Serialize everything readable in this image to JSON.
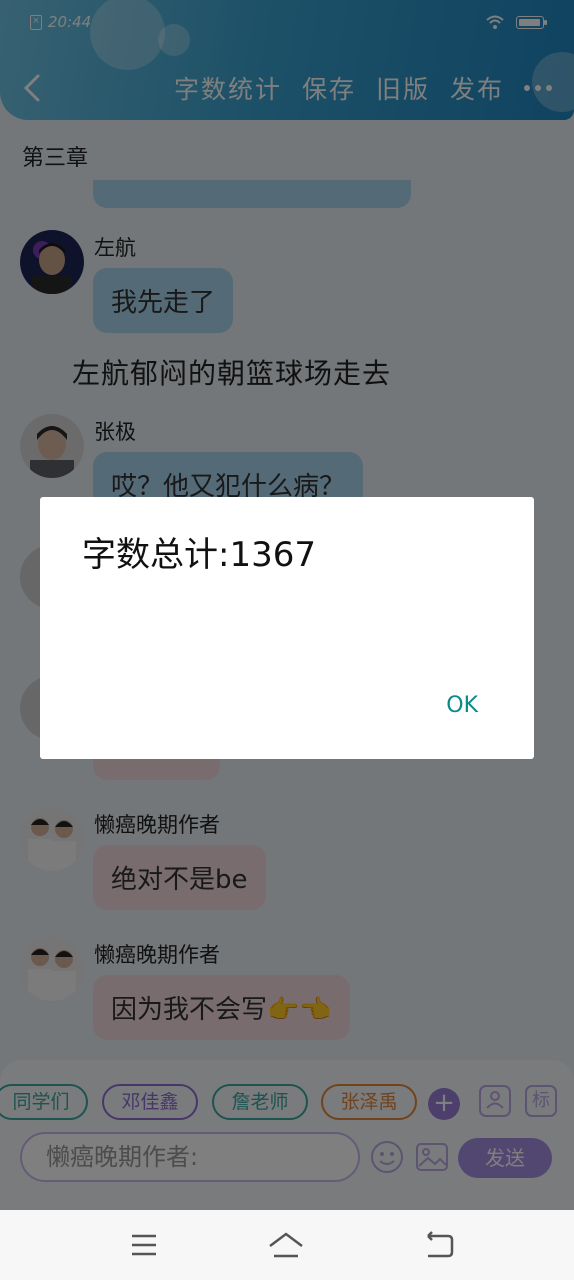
{
  "status_bar": {
    "time": "20:44",
    "sim_icon": "sim-x-icon",
    "wifi_icon": "wifi-icon",
    "battery_level": 0.8
  },
  "toolbar": {
    "back_icon": "chevron-left-icon",
    "word_count": "字数统计",
    "save": "保存",
    "old_version": "旧版",
    "publish": "发布",
    "more_icon": "more-dots-icon"
  },
  "chapter_title": "第三章",
  "messages": [
    {
      "name": "左航",
      "text": "我先走了",
      "bubble": "blue"
    },
    {
      "name": "张极",
      "text": "哎？他又犯什么病？",
      "bubble": "blue"
    },
    {
      "name": "懒癌晚期作者",
      "text": "绝对不是be",
      "bubble": "pink"
    },
    {
      "name": "懒癌晚期作者",
      "text": "因为我不会写👉👈",
      "bubble": "pink"
    }
  ],
  "narration": "左航郁闷的朝篮球场走去",
  "character_chips": [
    "同学们",
    "邓佳鑫",
    "詹老师",
    "张泽禹"
  ],
  "chip_colors": [
    "#3aa6a0",
    "#8e6ed1",
    "#3aa6a0",
    "#e0873a"
  ],
  "add_icon": "plus-icon",
  "side_icons": {
    "person": "person-icon",
    "tag_label": "标"
  },
  "input": {
    "placeholder": "懒癌晚期作者:"
  },
  "emoji_icon": "smiley-icon",
  "image_icon": "image-icon",
  "send_label": "发送",
  "dialog": {
    "message": "字数总计:1367",
    "ok_label": "OK"
  },
  "nav": {
    "menu_icon": "menu-icon",
    "home_icon": "home-icon",
    "back_icon": "back-arrow-icon"
  },
  "colors": {
    "header_start": "#6fc3e3",
    "header_end": "#1f86c0",
    "blue_bubble": "#a8d4ee",
    "pink_bubble": "#f2d9df",
    "accent_purple": "#a58fe3",
    "ok_teal": "#0a8a8a"
  }
}
